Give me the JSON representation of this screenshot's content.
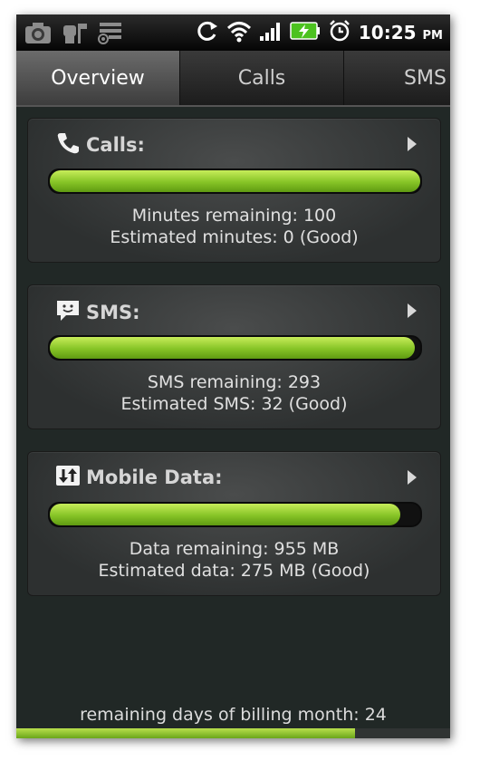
{
  "status_bar": {
    "icons": [
      "camera-icon",
      "robot-icon",
      "task-list-icon",
      "sync-icon",
      "wifi-icon",
      "signal-icon",
      "battery-charging-icon",
      "alarm-icon"
    ],
    "time": "10:25",
    "ampm": "PM"
  },
  "tabs": [
    {
      "label": "Overview",
      "active": true
    },
    {
      "label": "Calls",
      "active": false
    },
    {
      "label": "SMS",
      "active": false
    }
  ],
  "cards": {
    "calls": {
      "icon": "phone-icon",
      "title": "Calls:",
      "progress": 1.0,
      "line1": "Minutes remaining: 100",
      "line2": "Estimated minutes: 0 (Good)"
    },
    "sms": {
      "icon": "sms-icon",
      "title": "SMS:",
      "progress": 0.985,
      "line1": "SMS remaining: 293",
      "line2": "Estimated SMS: 32 (Good)"
    },
    "data": {
      "icon": "data-transfer-icon",
      "title": "Mobile Data:",
      "progress": 0.945,
      "line1": "Data remaining: 955 MB",
      "line2": "Estimated data: 275 MB (Good)"
    }
  },
  "footer": {
    "label": "remaining days of billing month:  24",
    "progress": 0.78
  },
  "colors": {
    "bar_green": "#86c426",
    "background": "#212826"
  }
}
